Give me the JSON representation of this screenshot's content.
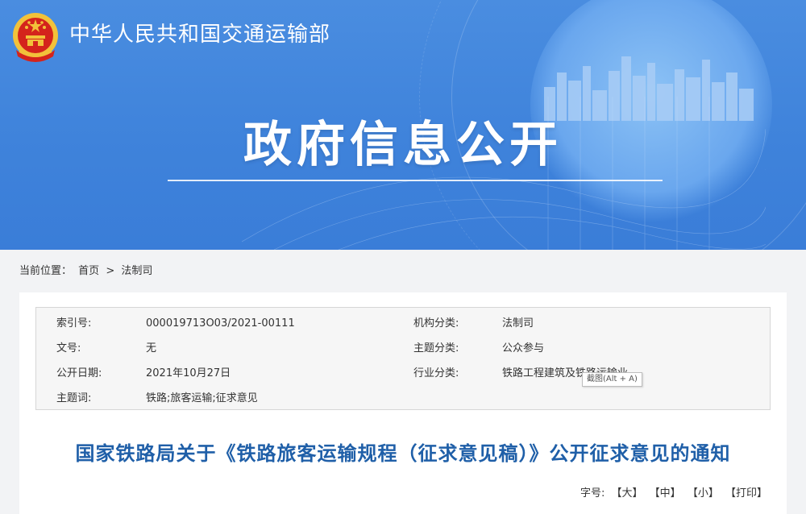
{
  "header": {
    "site_name": "中华人民共和国交通运输部",
    "banner_title": "政府信息公开"
  },
  "breadcrumb": {
    "label": "当前位置：",
    "home": "首页",
    "separator": ">",
    "current": "法制司"
  },
  "metadata": {
    "index_label": "索引号:",
    "index_value": "000019713O03/2021-00111",
    "org_label": "机构分类:",
    "org_value": "法制司",
    "docno_label": "文号:",
    "docno_value": "无",
    "topic_label": "主题分类:",
    "topic_value": "公众参与",
    "date_label": "公开日期:",
    "date_value": "2021年10月27日",
    "industry_label": "行业分类:",
    "industry_value": "铁路工程建筑及铁路运输业",
    "keywords_label": "主题词:",
    "keywords_value": "铁路;旅客运输;征求意见"
  },
  "tooltip": "截图(Alt + A)",
  "document": {
    "title": "国家铁路局关于《铁路旅客运输规程（征求意见稿）》公开征求意见的通知"
  },
  "font_size": {
    "label": "字号:",
    "large": "【大】",
    "medium": "【中】",
    "small": "【小】",
    "print": "【打印】"
  },
  "colors": {
    "banner_blue": "#3f83db",
    "title_blue": "#1f5fa8",
    "emblem_red": "#d4241c",
    "emblem_gold": "#f2c23a"
  }
}
